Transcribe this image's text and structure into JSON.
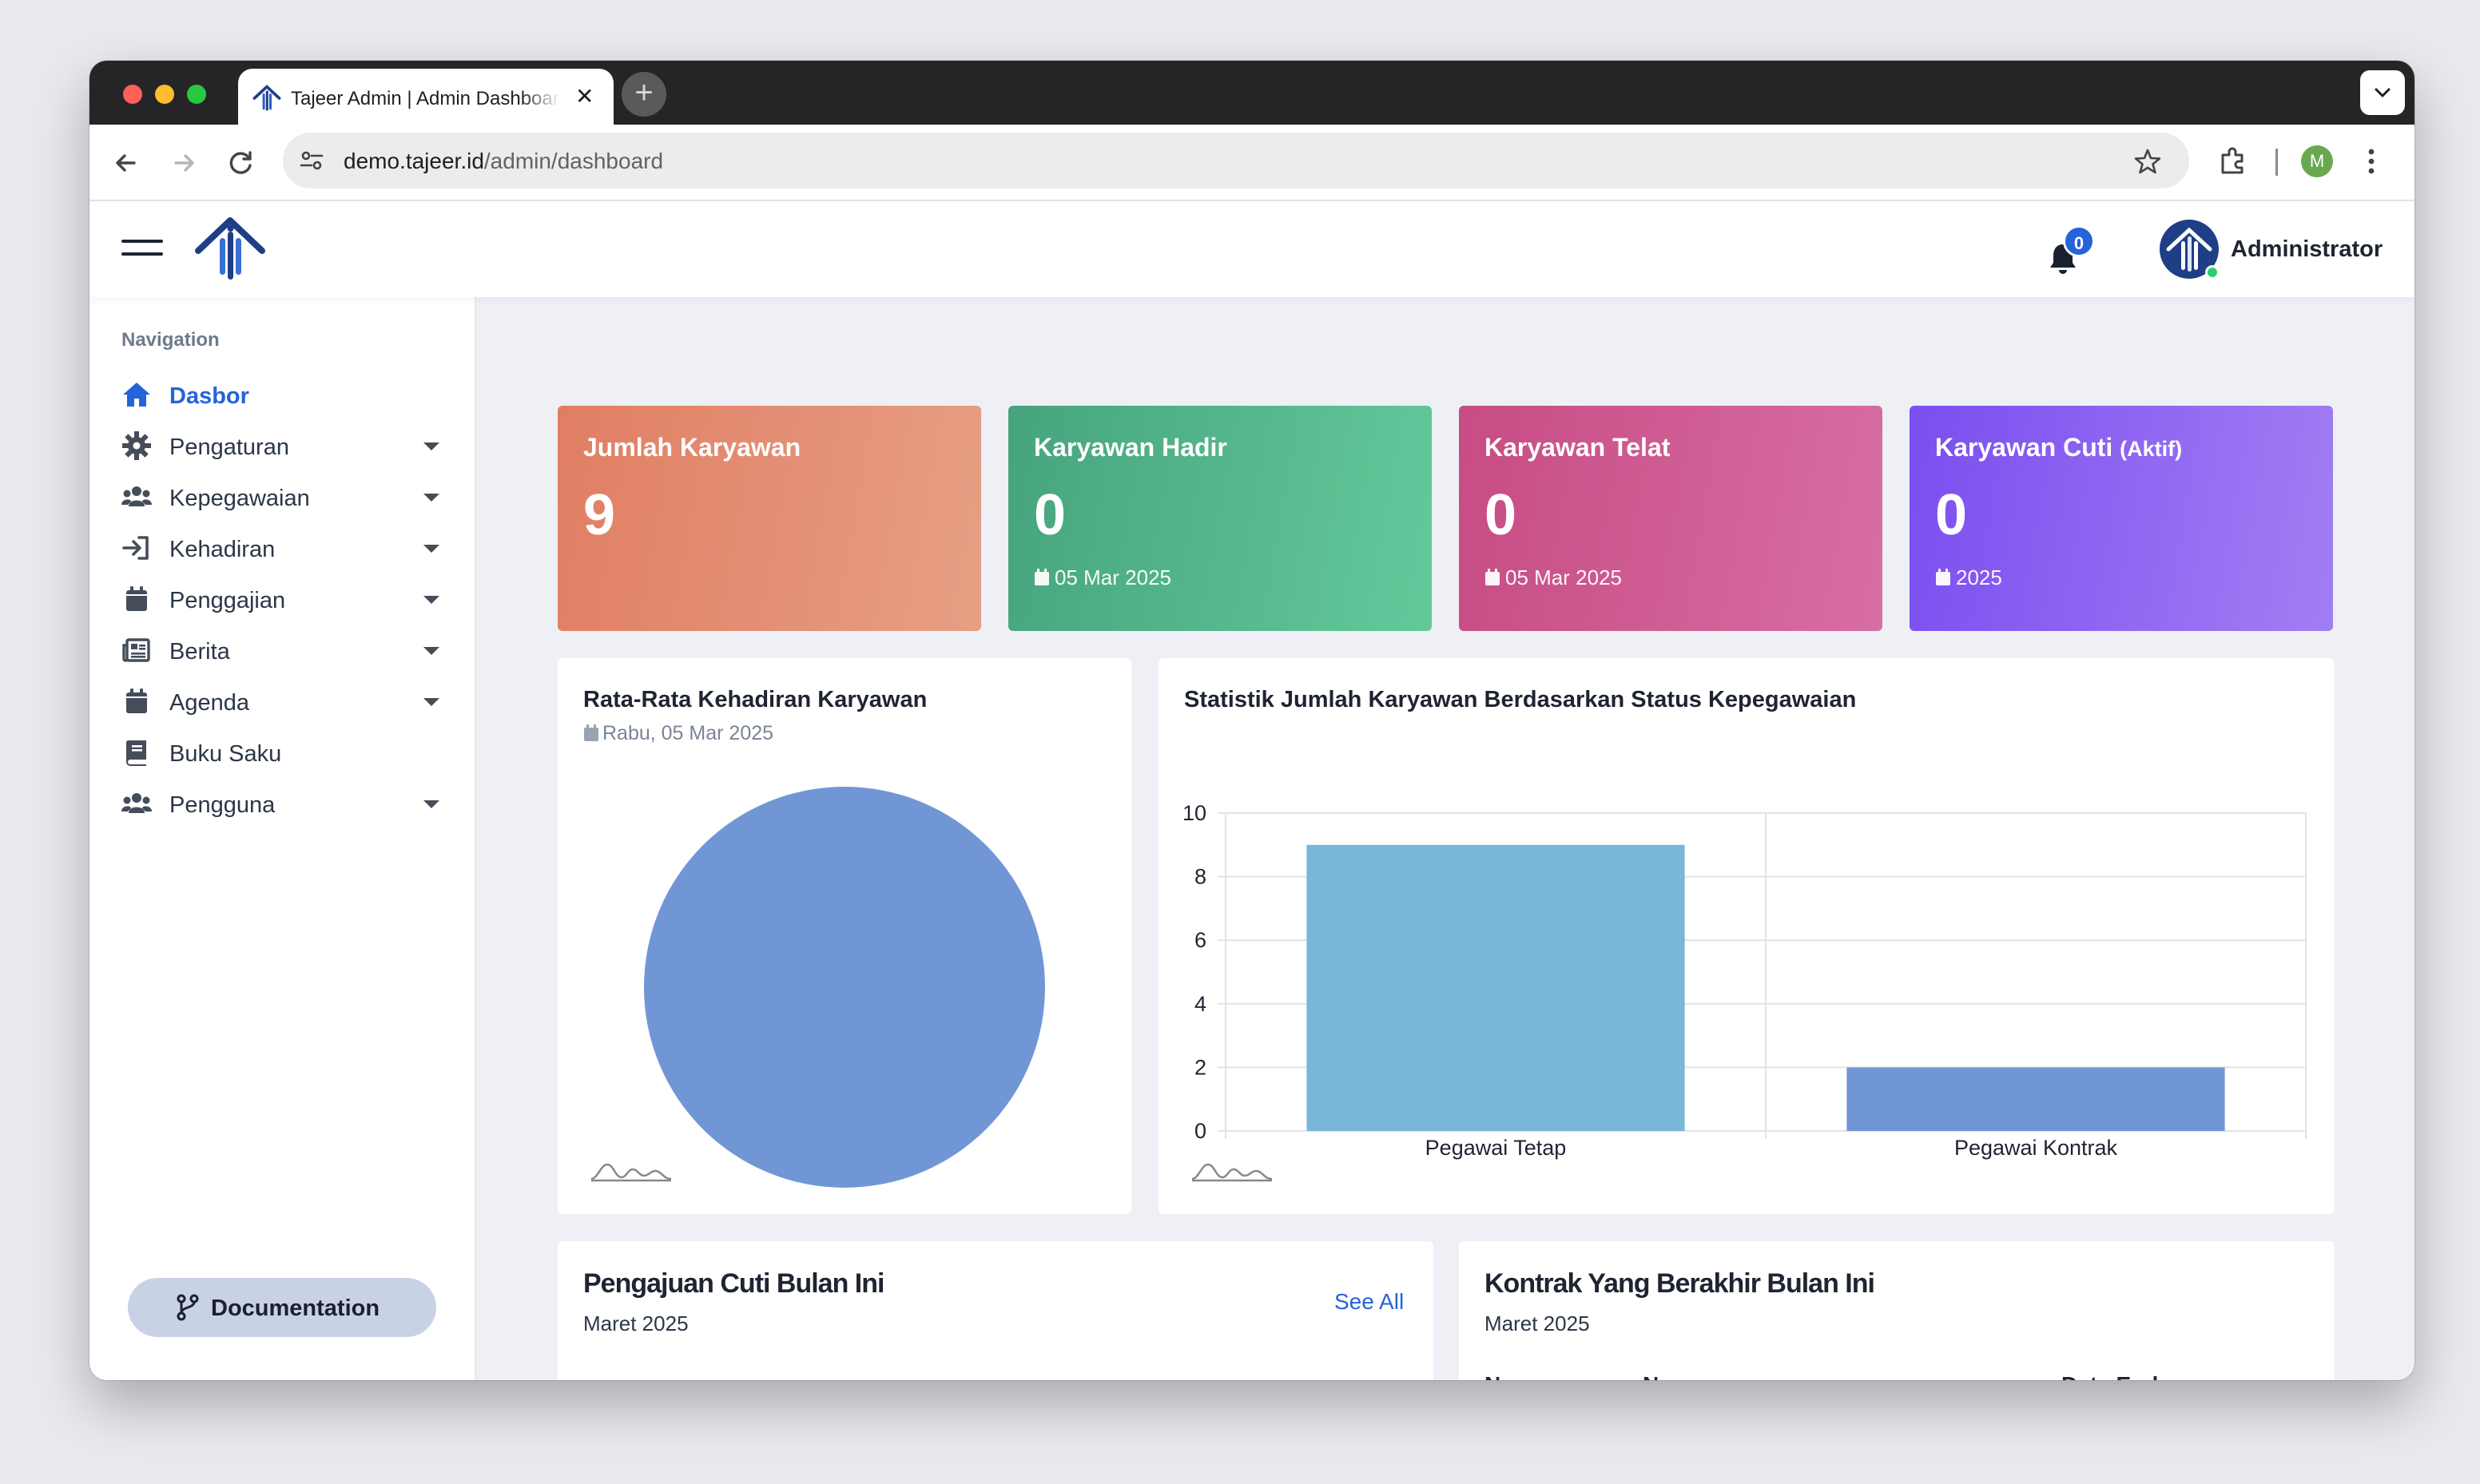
{
  "browser": {
    "tab_title": "Tajeer Admin | Admin Dashboard",
    "new_tab_label": "+",
    "url_domain": "demo.tajeer.id",
    "url_path": "/admin/dashboard",
    "profile_initial": "M"
  },
  "header": {
    "notification_count": "0",
    "user_name": "Administrator"
  },
  "sidebar": {
    "heading": "Navigation",
    "items": [
      {
        "label": "Dasbor",
        "icon": "home-icon",
        "active": true,
        "has_submenu": false
      },
      {
        "label": "Pengaturan",
        "icon": "gear-icon",
        "has_submenu": true
      },
      {
        "label": "Kepegawaian",
        "icon": "users-icon",
        "has_submenu": true
      },
      {
        "label": "Kehadiran",
        "icon": "sign-in-icon",
        "has_submenu": true
      },
      {
        "label": "Penggajian",
        "icon": "calendar-icon",
        "has_submenu": true
      },
      {
        "label": "Berita",
        "icon": "newspaper-icon",
        "has_submenu": true
      },
      {
        "label": "Agenda",
        "icon": "calendar-icon",
        "has_submenu": true
      },
      {
        "label": "Buku Saku",
        "icon": "book-icon",
        "has_submenu": false
      },
      {
        "label": "Pengguna",
        "icon": "users-icon",
        "has_submenu": true
      }
    ],
    "documentation_label": "Documentation"
  },
  "stats": [
    {
      "title": "Jumlah Karyawan",
      "title_small": "",
      "value": "9",
      "date": "",
      "colors": [
        "#e07e63",
        "#e79f84"
      ]
    },
    {
      "title": "Karyawan Hadir",
      "title_small": "",
      "value": "0",
      "date": "05 Mar 2025",
      "colors": [
        "#46a47c",
        "#63c99b"
      ]
    },
    {
      "title": "Karyawan Telat",
      "title_small": "",
      "value": "0",
      "date": "05 Mar 2025",
      "colors": [
        "#c74c83",
        "#d76ea4"
      ]
    },
    {
      "title": "Karyawan Cuti",
      "title_small": "(Aktif)",
      "value": "0",
      "date": "2025",
      "colors": [
        "#7b4ef0",
        "#a27ef3"
      ]
    }
  ],
  "attendance_panel": {
    "title": "Rata-Rata Kehadiran Karyawan",
    "date": "Rabu, 05 Mar 2025"
  },
  "status_panel": {
    "title": "Statistik Jumlah Karyawan Berdasarkan Status Kepegawaian"
  },
  "leave_panel": {
    "title": "Pengajuan Cuti Bulan Ini",
    "subtitle": "Maret 2025",
    "see_all": "See All"
  },
  "contract_panel": {
    "title": "Kontrak Yang Berakhir Bulan Ini",
    "subtitle": "Maret 2025",
    "columns": [
      "No",
      "Name",
      "Date End"
    ]
  },
  "chart_data": [
    {
      "type": "pie",
      "values": [
        1
      ],
      "colors": [
        "#7096d6"
      ]
    },
    {
      "type": "bar",
      "categories": [
        "Pegawai Tetap",
        "Pegawai Kontrak"
      ],
      "values": [
        9,
        2
      ],
      "colors": [
        "#79b6d8",
        "#7096d6"
      ],
      "ylim": [
        0,
        10
      ],
      "yticks": [
        "0",
        "2",
        "4",
        "6",
        "8",
        "10"
      ],
      "grid": true
    }
  ]
}
